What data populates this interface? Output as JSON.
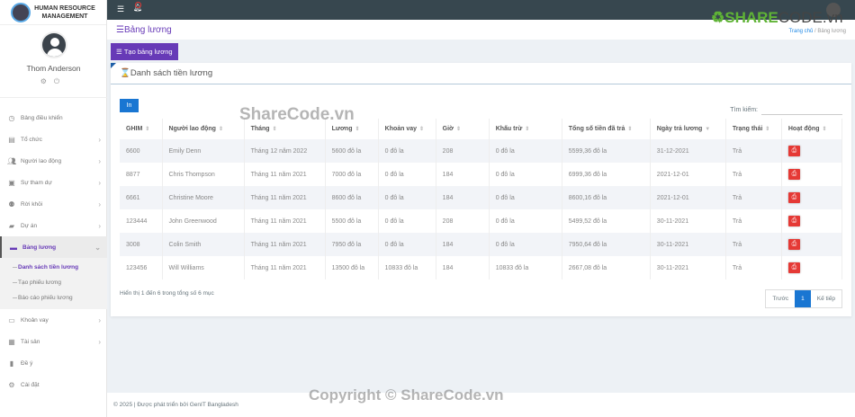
{
  "sidebar": {
    "logo_line1": "HUMAN RESOURCE",
    "logo_line2": "MANAGEMENT",
    "user_name": "Thom Anderson",
    "items": [
      {
        "label": "Bảng điều khiển",
        "icon": "dashboard-icon",
        "chev": ""
      },
      {
        "label": "Tổ chức",
        "icon": "building-icon",
        "chev": "›"
      },
      {
        "label": "Người lao động",
        "icon": "people-icon",
        "chev": "›"
      },
      {
        "label": "Sự tham dự",
        "icon": "clipboard-icon",
        "chev": "›"
      },
      {
        "label": "Rời khỏi",
        "icon": "user-leave-icon",
        "chev": "›"
      },
      {
        "label": "Dự án",
        "icon": "briefcase-icon",
        "chev": "›"
      },
      {
        "label": "Bảng lương",
        "icon": "payroll-icon",
        "chev": "⌄"
      },
      {
        "label": "Khoản vay",
        "icon": "money-icon",
        "chev": "›"
      },
      {
        "label": "Tài sản",
        "icon": "grid-icon",
        "chev": "›"
      },
      {
        "label": "Đề ý",
        "icon": "bag-icon",
        "chev": ""
      },
      {
        "label": "Cài đặt",
        "icon": "gear-icon",
        "chev": ""
      }
    ],
    "subitems": [
      "Danh sách tiền lương",
      "Tạo phiếu lương",
      "Báo cáo phiếu lương"
    ]
  },
  "header": {
    "title": "Bảng lương",
    "breadcrumb_home": "Trang chủ",
    "breadcrumb_sep": "/",
    "breadcrumb_current": "Bảng lương"
  },
  "toolbar": {
    "create_label": "Tạo bảng lương"
  },
  "card": {
    "title": "Danh sách tiền lương",
    "print_label": "In",
    "search_label": "Tìm kiếm:",
    "search_value": ""
  },
  "table": {
    "columns": [
      "GHIM",
      "Người lao động",
      "Tháng",
      "Lương",
      "Khoản vay",
      "Giờ",
      "Khấu trừ",
      "Tổng số tiền đã trả",
      "Ngày trả lương",
      "Trạng thái",
      "Hoạt động"
    ],
    "rows": [
      [
        "6600",
        "Emily Denn",
        "Tháng 12 năm 2022",
        "5600 đô la",
        "0 đô la",
        "208",
        "0 đô la",
        "5599,36 đô la",
        "31-12-2021",
        "Trả"
      ],
      [
        "8877",
        "Chris Thompson",
        "Tháng 11 năm 2021",
        "7000 đô la",
        "0 đô la",
        "184",
        "0 đô la",
        "6999,36 đô la",
        "2021-12-01",
        "Trả"
      ],
      [
        "6661",
        "Christine Moore",
        "Tháng 11 năm 2021",
        "8600 đô la",
        "0 đô la",
        "184",
        "0 đô la",
        "8600,16 đô la",
        "2021-12-01",
        "Trả"
      ],
      [
        "123444",
        "John Greenwood",
        "Tháng 11 năm 2021",
        "5500 đô la",
        "0 đô la",
        "208",
        "0 đô la",
        "5499,52 đô la",
        "30-11-2021",
        "Trả"
      ],
      [
        "3008",
        "Colin Smith",
        "Tháng 11 năm 2021",
        "7950 đô la",
        "0 đô la",
        "184",
        "0 đô la",
        "7950,64 đô la",
        "30-11-2021",
        "Trả"
      ],
      [
        "123456",
        "Will Williams",
        "Tháng 11 năm 2021",
        "13500 đô la",
        "10833 đô la",
        "184",
        "10833 đô la",
        "2667,08 đô la",
        "30-11-2021",
        "Trả"
      ]
    ]
  },
  "pagination": {
    "info": "Hiển thị 1 đến 6 trong tổng số 6 mục",
    "prev": "Trước",
    "page": "1",
    "next": "Kế tiếp"
  },
  "footer": {
    "text": "© 2025 | Được phát triển bởi GenIT Bangladesh"
  },
  "watermarks": {
    "logo_a": "SHARE",
    "logo_b": "CODE.vn",
    "center": "ShareCode.vn",
    "bottom": "Copyright © ShareCode.vn"
  },
  "colors": {
    "accent": "#673ab7",
    "primary": "#1976d2",
    "danger": "#e53935",
    "topbar": "#37474f"
  }
}
